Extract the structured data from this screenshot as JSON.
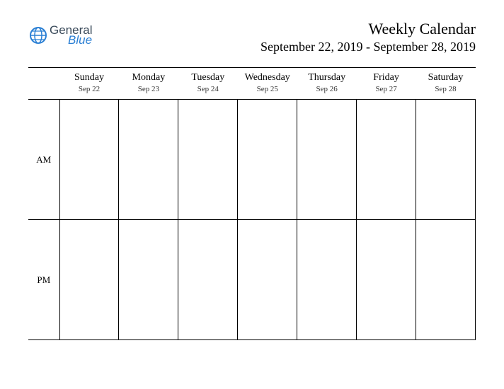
{
  "logo": {
    "word1": "General",
    "word2": "Blue"
  },
  "header": {
    "title": "Weekly Calendar",
    "date_range": "September 22, 2019 - September 28, 2019"
  },
  "days": [
    {
      "name": "Sunday",
      "date": "Sep 22"
    },
    {
      "name": "Monday",
      "date": "Sep 23"
    },
    {
      "name": "Tuesday",
      "date": "Sep 24"
    },
    {
      "name": "Wednesday",
      "date": "Sep 25"
    },
    {
      "name": "Thursday",
      "date": "Sep 26"
    },
    {
      "name": "Friday",
      "date": "Sep 27"
    },
    {
      "name": "Saturday",
      "date": "Sep 28"
    }
  ],
  "rows": [
    {
      "label": "AM"
    },
    {
      "label": "PM"
    }
  ]
}
